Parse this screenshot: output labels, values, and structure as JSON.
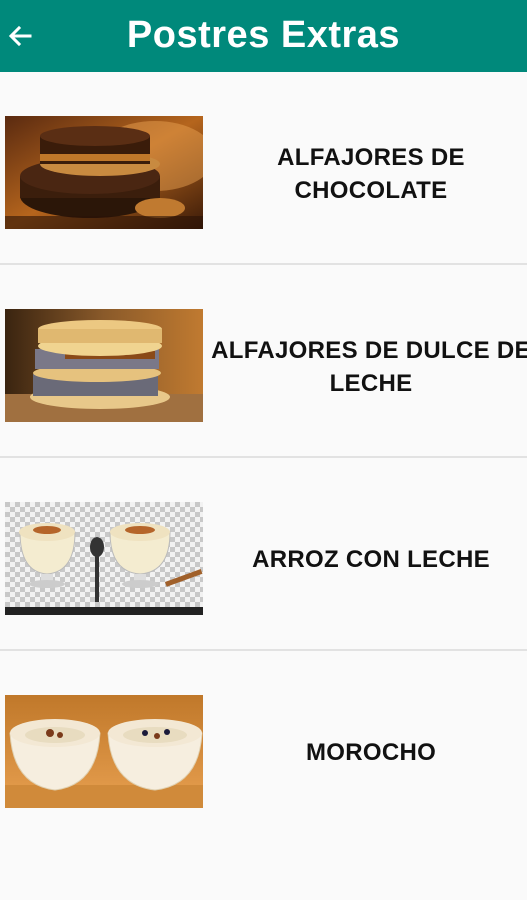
{
  "appbar": {
    "title": "Postres Extras",
    "back_icon": "arrow-left-icon",
    "color": "#00897b"
  },
  "items": [
    {
      "label": "ALFAJORES DE CHOCOLATE",
      "image": "chocolate-alfajores-image"
    },
    {
      "label": "ALFAJORES DE DULCE DE LECHE",
      "image": "dulce-de-leche-alfajores-image"
    },
    {
      "label": "ARROZ CON LECHE",
      "image": "rice-pudding-image"
    },
    {
      "label": "MOROCHO",
      "image": "morocho-image"
    }
  ]
}
